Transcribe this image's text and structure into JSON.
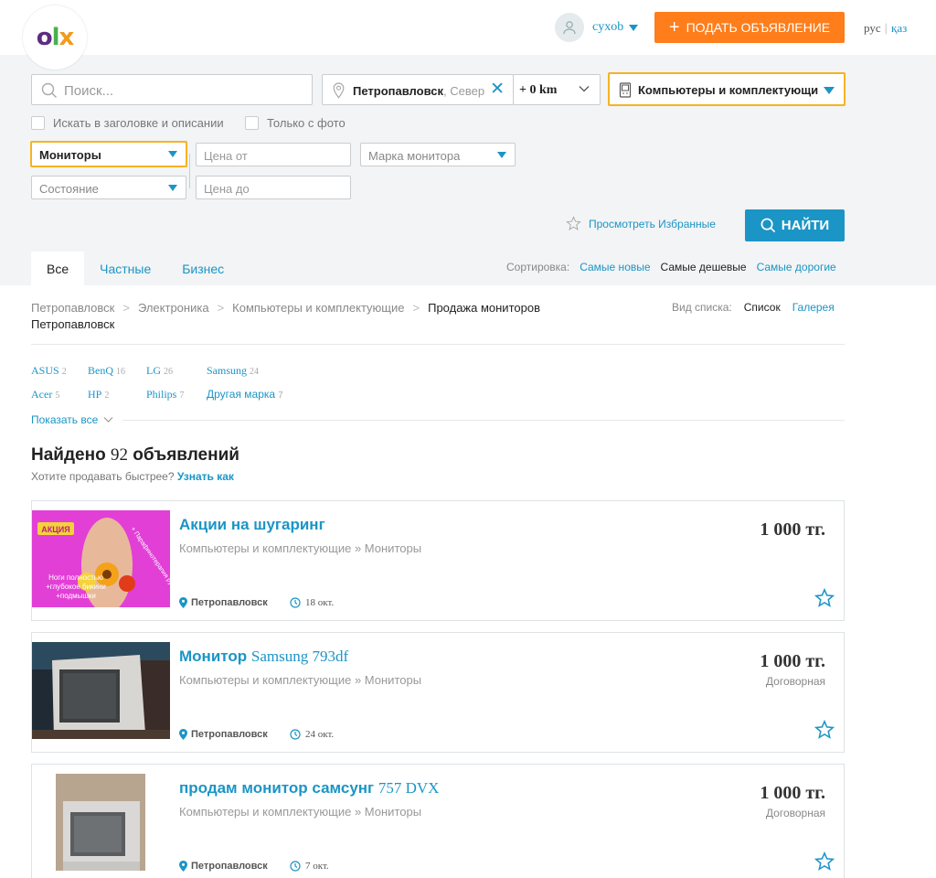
{
  "header": {
    "logo_text": "OLX",
    "user_name": "cyxob",
    "post_button": "ПОДАТЬ ОБЪЯВЛЕНИЕ",
    "lang_ru": "рус",
    "lang_kz": "қаз"
  },
  "search": {
    "placeholder": "Поиск...",
    "city": "Петропавловск",
    "city_tail": ", Север",
    "radius": "+ 0 km",
    "category": "Компьютеры и комплектующи",
    "check_title_desc": "Искать в заголовке и описании",
    "check_photo": "Только с фото",
    "subcategory": "Мониторы",
    "state": "Состояние",
    "price_from": "Цена от",
    "price_to": "Цена до",
    "brand": "Марка монитора",
    "favorites": "Просмотреть Избранные",
    "find_button": "НАЙТИ"
  },
  "tabs": [
    "Все",
    "Частные",
    "Бизнес"
  ],
  "sort": {
    "label": "Сортировка:",
    "options": [
      "Самые новые",
      "Самые дешевые",
      "Самые дорогие"
    ]
  },
  "breadcrumbs": {
    "items": [
      "Петропавловск",
      "Электроника",
      "Компьютеры и комплектующие",
      "Продажа мониторов"
    ],
    "line2": "Петропавловск"
  },
  "view": {
    "label": "Вид списка:",
    "list": "Список",
    "gallery": "Галерея"
  },
  "brands": [
    {
      "name": "ASUS",
      "count": "2"
    },
    {
      "name": "BenQ",
      "count": "16"
    },
    {
      "name": "LG",
      "count": "26"
    },
    {
      "name": "Samsung",
      "count": "24"
    },
    {
      "name": "Acer",
      "count": "5"
    },
    {
      "name": "HP",
      "count": "2"
    },
    {
      "name": "Philips",
      "count": "7"
    },
    {
      "name": "Другая марка",
      "count": "7"
    }
  ],
  "show_all": "Показать все",
  "results": {
    "found_prefix": "Найдено",
    "count": "92",
    "found_suffix": "объявлений",
    "sell_question": "Хотите продавать быстрее?",
    "sell_link": "Узнать как"
  },
  "listings": [
    {
      "title": "Акции на шугаринг",
      "title_tail": "",
      "category": "Компьютеры и комплектующие » Мониторы",
      "price": "1 000 тг.",
      "negotiable": "",
      "location": "Петропавловск",
      "date": "18 окт.",
      "promo": {
        "badge": "АКЦИЯ",
        "diag": "+ Парафинотерапия рук в подарок",
        "lines": [
          "Ноги полностью",
          "+глубокое бикини",
          "+подмышки"
        ]
      }
    },
    {
      "title": "Монитор",
      "title_tail": "Samsung 793df",
      "category": "Компьютеры и комплектующие » Мониторы",
      "price": "1 000 тг.",
      "negotiable": "Договорная",
      "location": "Петропавловск",
      "date": "24 окт."
    },
    {
      "title": "продам монитор самсунг",
      "title_tail": "757 DVX",
      "category": "Компьютеры и комплектующие » Мониторы",
      "price": "1 000 тг.",
      "negotiable": "Договорная",
      "location": "Петропавловск",
      "date": "7 окт."
    }
  ],
  "colors": {
    "accent": "#1b95c6",
    "orange": "#ff7d1a",
    "highlight": "#f5b323",
    "panel_bg": "#f2f4f5"
  },
  "icons": [
    "user-icon",
    "search-icon",
    "location-pin-icon",
    "clear-icon",
    "chevron-down-icon",
    "phone-category-icon",
    "star-outline-icon",
    "clock-icon"
  ]
}
